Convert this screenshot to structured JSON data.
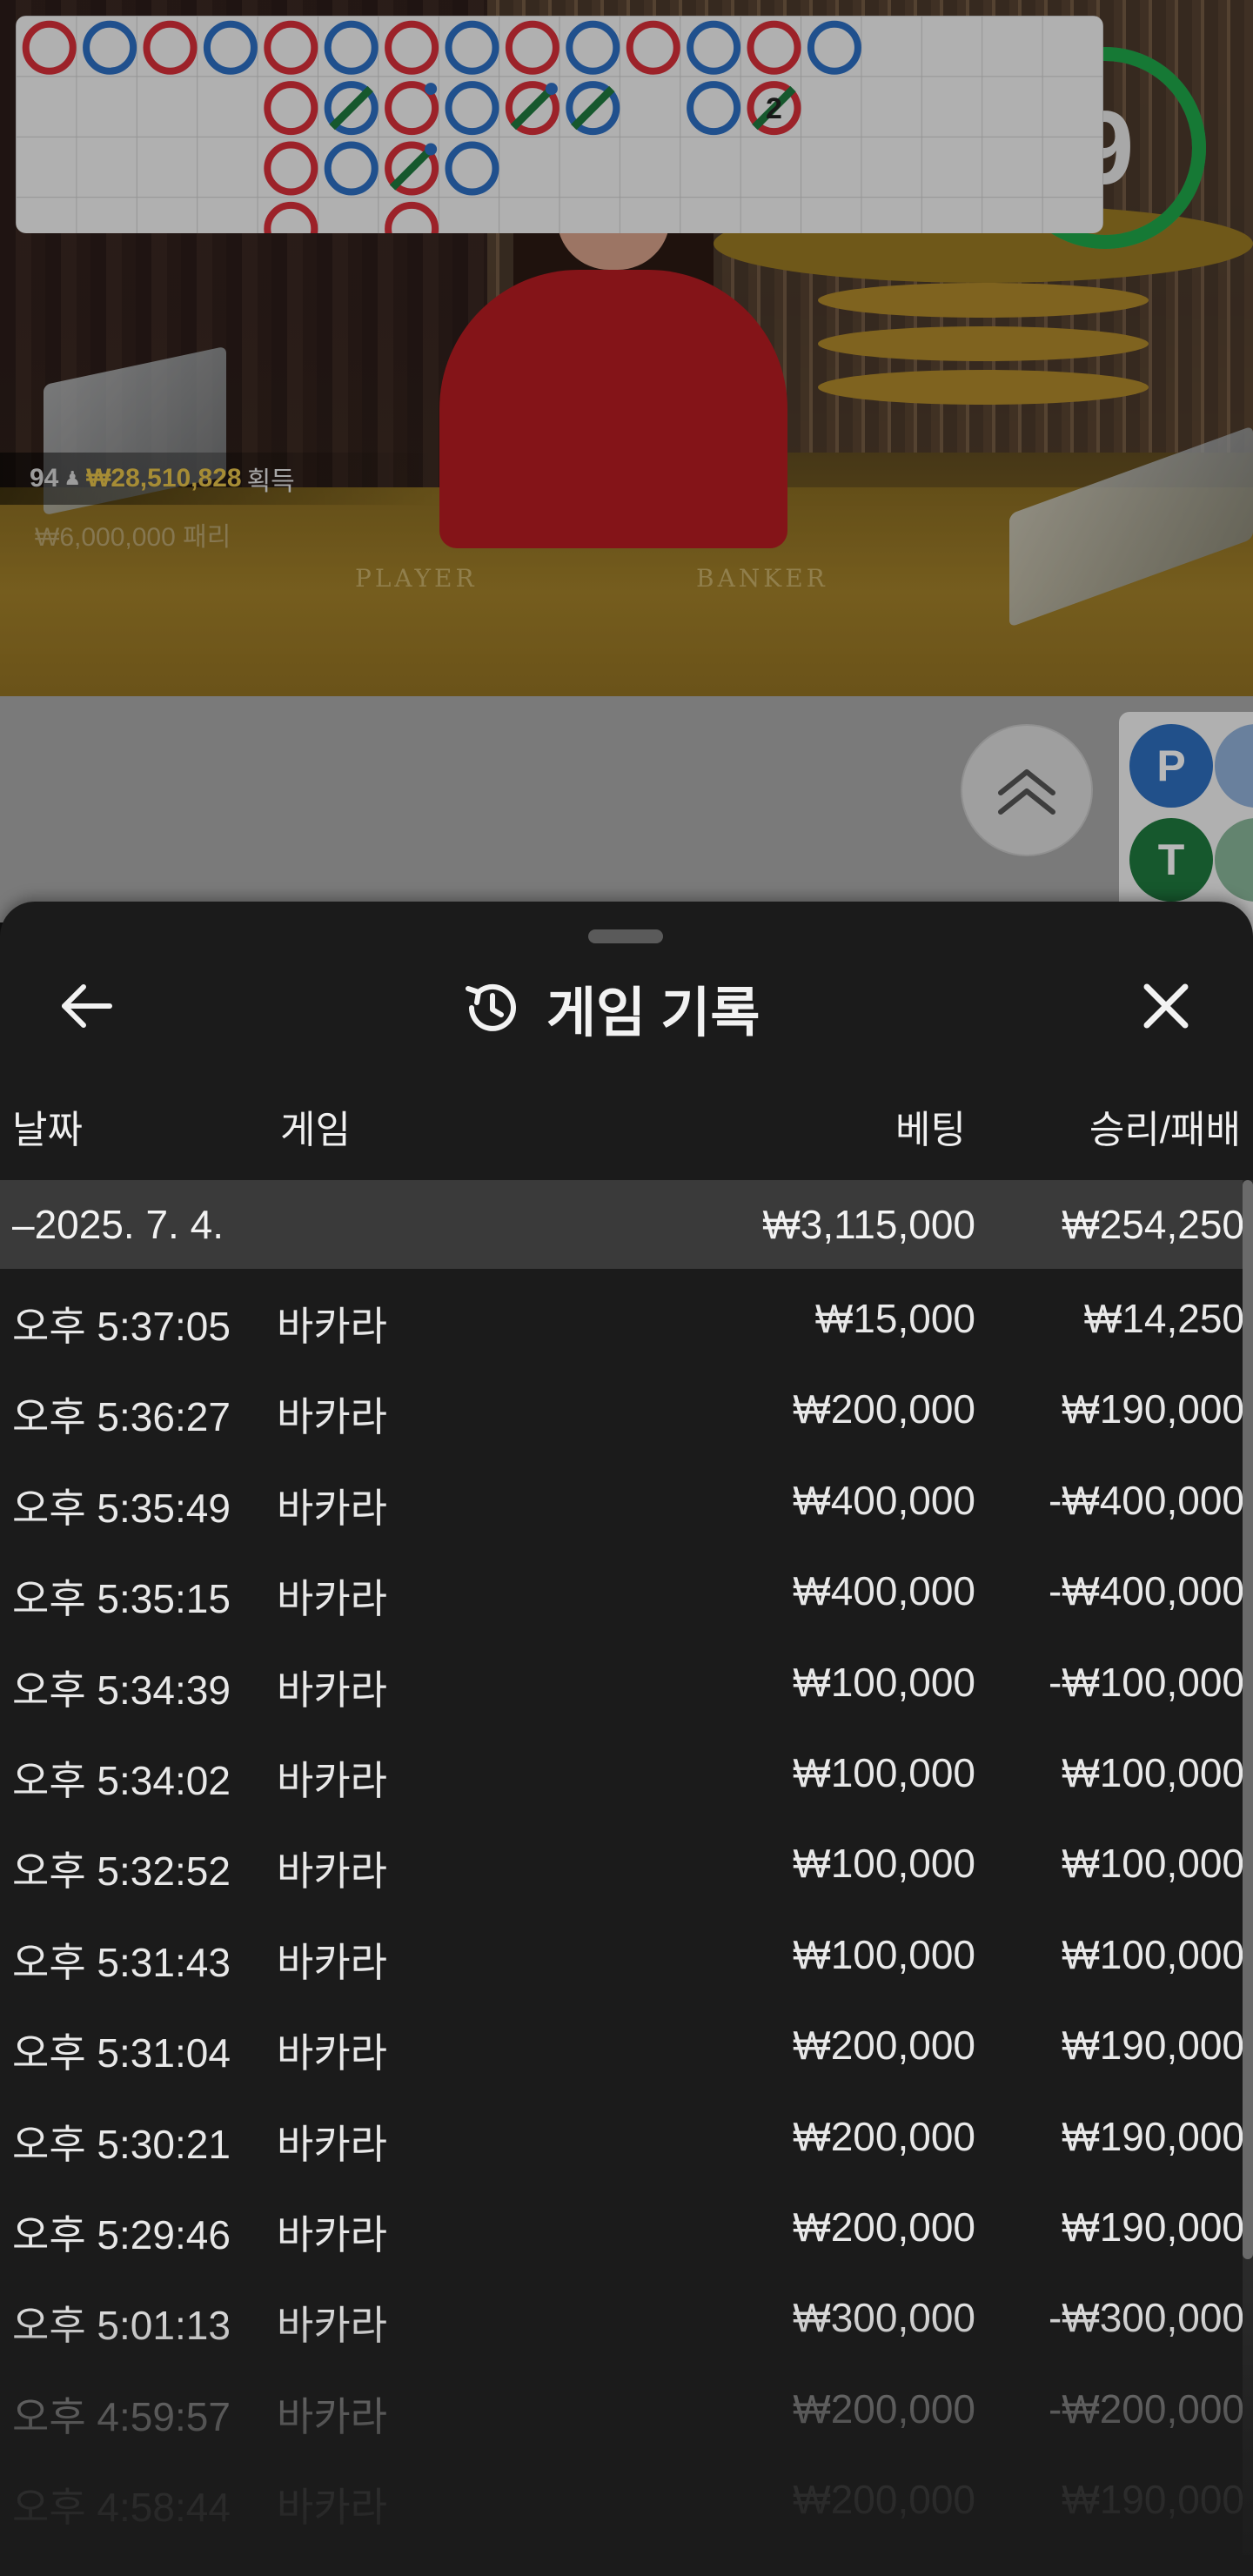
{
  "video": {
    "timer": "9",
    "winners": {
      "count": "94",
      "amount": "₩28,510,828",
      "suffix": "획득"
    },
    "losers": "₩6,000,000  패리",
    "table_labels": {
      "player": "PLAYER",
      "banker": "BANKER"
    }
  },
  "roadmap": {
    "tie_count": "2",
    "side_buttons": [
      {
        "letter": "P",
        "color": "#2f6fbf"
      },
      {
        "letter": "T",
        "color": "#1f7a3f"
      }
    ]
  },
  "sheet": {
    "title": "게임 기록",
    "columns": {
      "date": "날짜",
      "game": "게임",
      "bet": "베팅",
      "result": "승리/패배"
    },
    "summary": {
      "date": "–2025. 7. 4.",
      "bet": "₩3,115,000",
      "result": "₩254,250"
    },
    "rows": [
      {
        "time": "오후 5:37:05",
        "game": "바카라",
        "bet": "₩15,000",
        "result": "₩14,250"
      },
      {
        "time": "오후 5:36:27",
        "game": "바카라",
        "bet": "₩200,000",
        "result": "₩190,000"
      },
      {
        "time": "오후 5:35:49",
        "game": "바카라",
        "bet": "₩400,000",
        "result": "-₩400,000"
      },
      {
        "time": "오후 5:35:15",
        "game": "바카라",
        "bet": "₩400,000",
        "result": "-₩400,000"
      },
      {
        "time": "오후 5:34:39",
        "game": "바카라",
        "bet": "₩100,000",
        "result": "-₩100,000"
      },
      {
        "time": "오후 5:34:02",
        "game": "바카라",
        "bet": "₩100,000",
        "result": "₩100,000"
      },
      {
        "time": "오후 5:32:52",
        "game": "바카라",
        "bet": "₩100,000",
        "result": "₩100,000"
      },
      {
        "time": "오후 5:31:43",
        "game": "바카라",
        "bet": "₩100,000",
        "result": "₩100,000"
      },
      {
        "time": "오후 5:31:04",
        "game": "바카라",
        "bet": "₩200,000",
        "result": "₩190,000"
      },
      {
        "time": "오후 5:30:21",
        "game": "바카라",
        "bet": "₩200,000",
        "result": "₩190,000"
      },
      {
        "time": "오후 5:29:46",
        "game": "바카라",
        "bet": "₩200,000",
        "result": "₩190,000"
      },
      {
        "time": "오후 5:01:13",
        "game": "바카라",
        "bet": "₩300,000",
        "result": "-₩300,000"
      },
      {
        "time": "오후 4:59:57",
        "game": "바카라",
        "bet": "₩200,000",
        "result": "-₩200,000"
      },
      {
        "time": "오후 4:58:44",
        "game": "바카라",
        "bet": "₩200,000",
        "result": "₩190,000"
      }
    ]
  },
  "colors": {
    "banker_red": "#d8303a",
    "player_blue": "#2d6fc4",
    "tie_green": "#1f7a3f",
    "timer_green": "#1fa84a"
  }
}
